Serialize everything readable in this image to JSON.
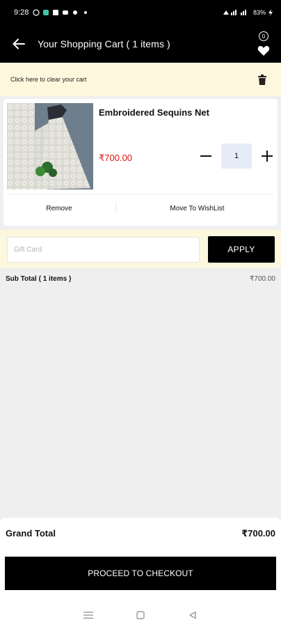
{
  "status_bar": {
    "time": "9:28",
    "battery": "83%"
  },
  "header": {
    "title": "Your Shopping Cart ( 1 items )",
    "wishlist_count": "0"
  },
  "clear_cart": {
    "label": "Click here to clear your cart"
  },
  "cart_items": [
    {
      "name": "Embroidered Sequins Net",
      "price": "₹700.00",
      "quantity": "1",
      "remove_label": "Remove",
      "wishlist_label": "Move To WishList"
    }
  ],
  "gift_card": {
    "placeholder": "Gift Card",
    "value": "",
    "apply_label": "APPLY"
  },
  "subtotal": {
    "label": "Sub Total ( 1 items )",
    "value": "₹700.00"
  },
  "grand_total": {
    "label": "Grand Total",
    "value": "₹700.00"
  },
  "checkout": {
    "label": "PROCEED TO CHECKOUT"
  },
  "colors": {
    "header_bg": "#000000",
    "banner_bg": "#fdf8dd",
    "price_red": "#e01010",
    "qty_bg": "#e6ecf7",
    "page_bg": "#efefef"
  },
  "icons": {
    "back": "arrow-left-icon",
    "wishlist": "heart-icon",
    "trash": "trash-icon",
    "minus": "minus-icon",
    "plus": "plus-icon",
    "nav_menu": "menu-icon",
    "nav_home": "square-icon",
    "nav_back": "triangle-back-icon"
  }
}
